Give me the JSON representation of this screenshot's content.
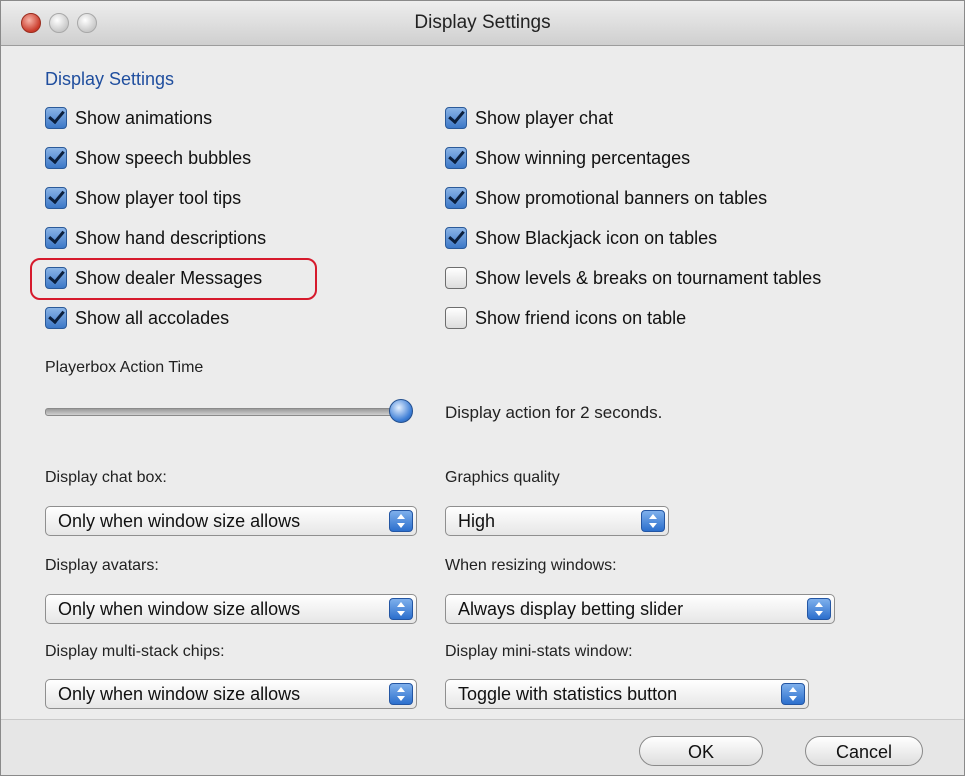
{
  "window": {
    "title": "Display Settings"
  },
  "section": {
    "title": "Display Settings"
  },
  "checkboxes_left": [
    {
      "label": "Show animations",
      "checked": true
    },
    {
      "label": "Show speech bubbles",
      "checked": true
    },
    {
      "label": "Show player tool tips",
      "checked": true
    },
    {
      "label": "Show hand descriptions",
      "checked": true
    },
    {
      "label": "Show dealer Messages",
      "checked": true
    },
    {
      "label": "Show all accolades",
      "checked": true
    }
  ],
  "checkboxes_right": [
    {
      "label": "Show player chat",
      "checked": true
    },
    {
      "label": "Show winning percentages",
      "checked": true
    },
    {
      "label": "Show promotional banners on tables",
      "checked": true
    },
    {
      "label": "Show Blackjack icon on tables",
      "checked": true
    },
    {
      "label": "Show levels & breaks on tournament tables",
      "checked": false
    },
    {
      "label": "Show friend icons on table",
      "checked": false
    }
  ],
  "action_time": {
    "label": "Playerbox Action Time",
    "description": "Display action for 2 seconds.",
    "slider_value_fraction": 1.0
  },
  "selects": {
    "chat_box": {
      "label": "Display chat box:",
      "value": "Only when window size allows"
    },
    "avatars": {
      "label": "Display avatars:",
      "value": "Only when window size allows"
    },
    "multi_stack": {
      "label": "Display multi-stack chips:",
      "value": "Only when window size allows"
    },
    "graphics": {
      "label": "Graphics quality",
      "value": "High"
    },
    "resizing": {
      "label": "When resizing windows:",
      "value": "Always display betting slider"
    },
    "mini_stats": {
      "label": "Display mini-stats window:",
      "value": "Toggle with statistics button"
    }
  },
  "buttons": {
    "ok": "OK",
    "cancel": "Cancel"
  },
  "colors": {
    "accent_blue": "#1f4e9e",
    "highlight_red": "#d61a2c"
  }
}
